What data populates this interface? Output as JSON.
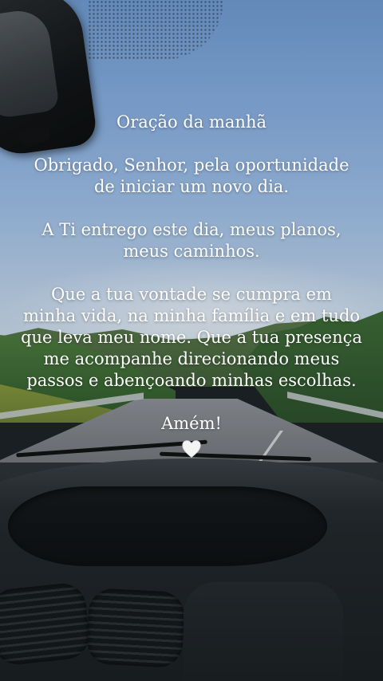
{
  "prayer": {
    "title": "Oração da manhã",
    "paragraph_1": "Obrigado, Senhor, pela oportunidade\nde iniciar um novo dia.",
    "paragraph_2": "A Ti entrego este dia, meus planos,\nmeus caminhos.",
    "paragraph_3": "Que a tua vontade se cumpra em\nminha vida, na minha família e em tudo\nque leva meu nome. Que a tua presença\nme acompanhe direcionando meus\npassos e abençoando minhas escolhas.",
    "closing": "Amém!",
    "heart_icon": "white-heart-icon"
  },
  "scene": {
    "description_icon": "car-windshield-road-background",
    "text_color": "#ffffff"
  }
}
